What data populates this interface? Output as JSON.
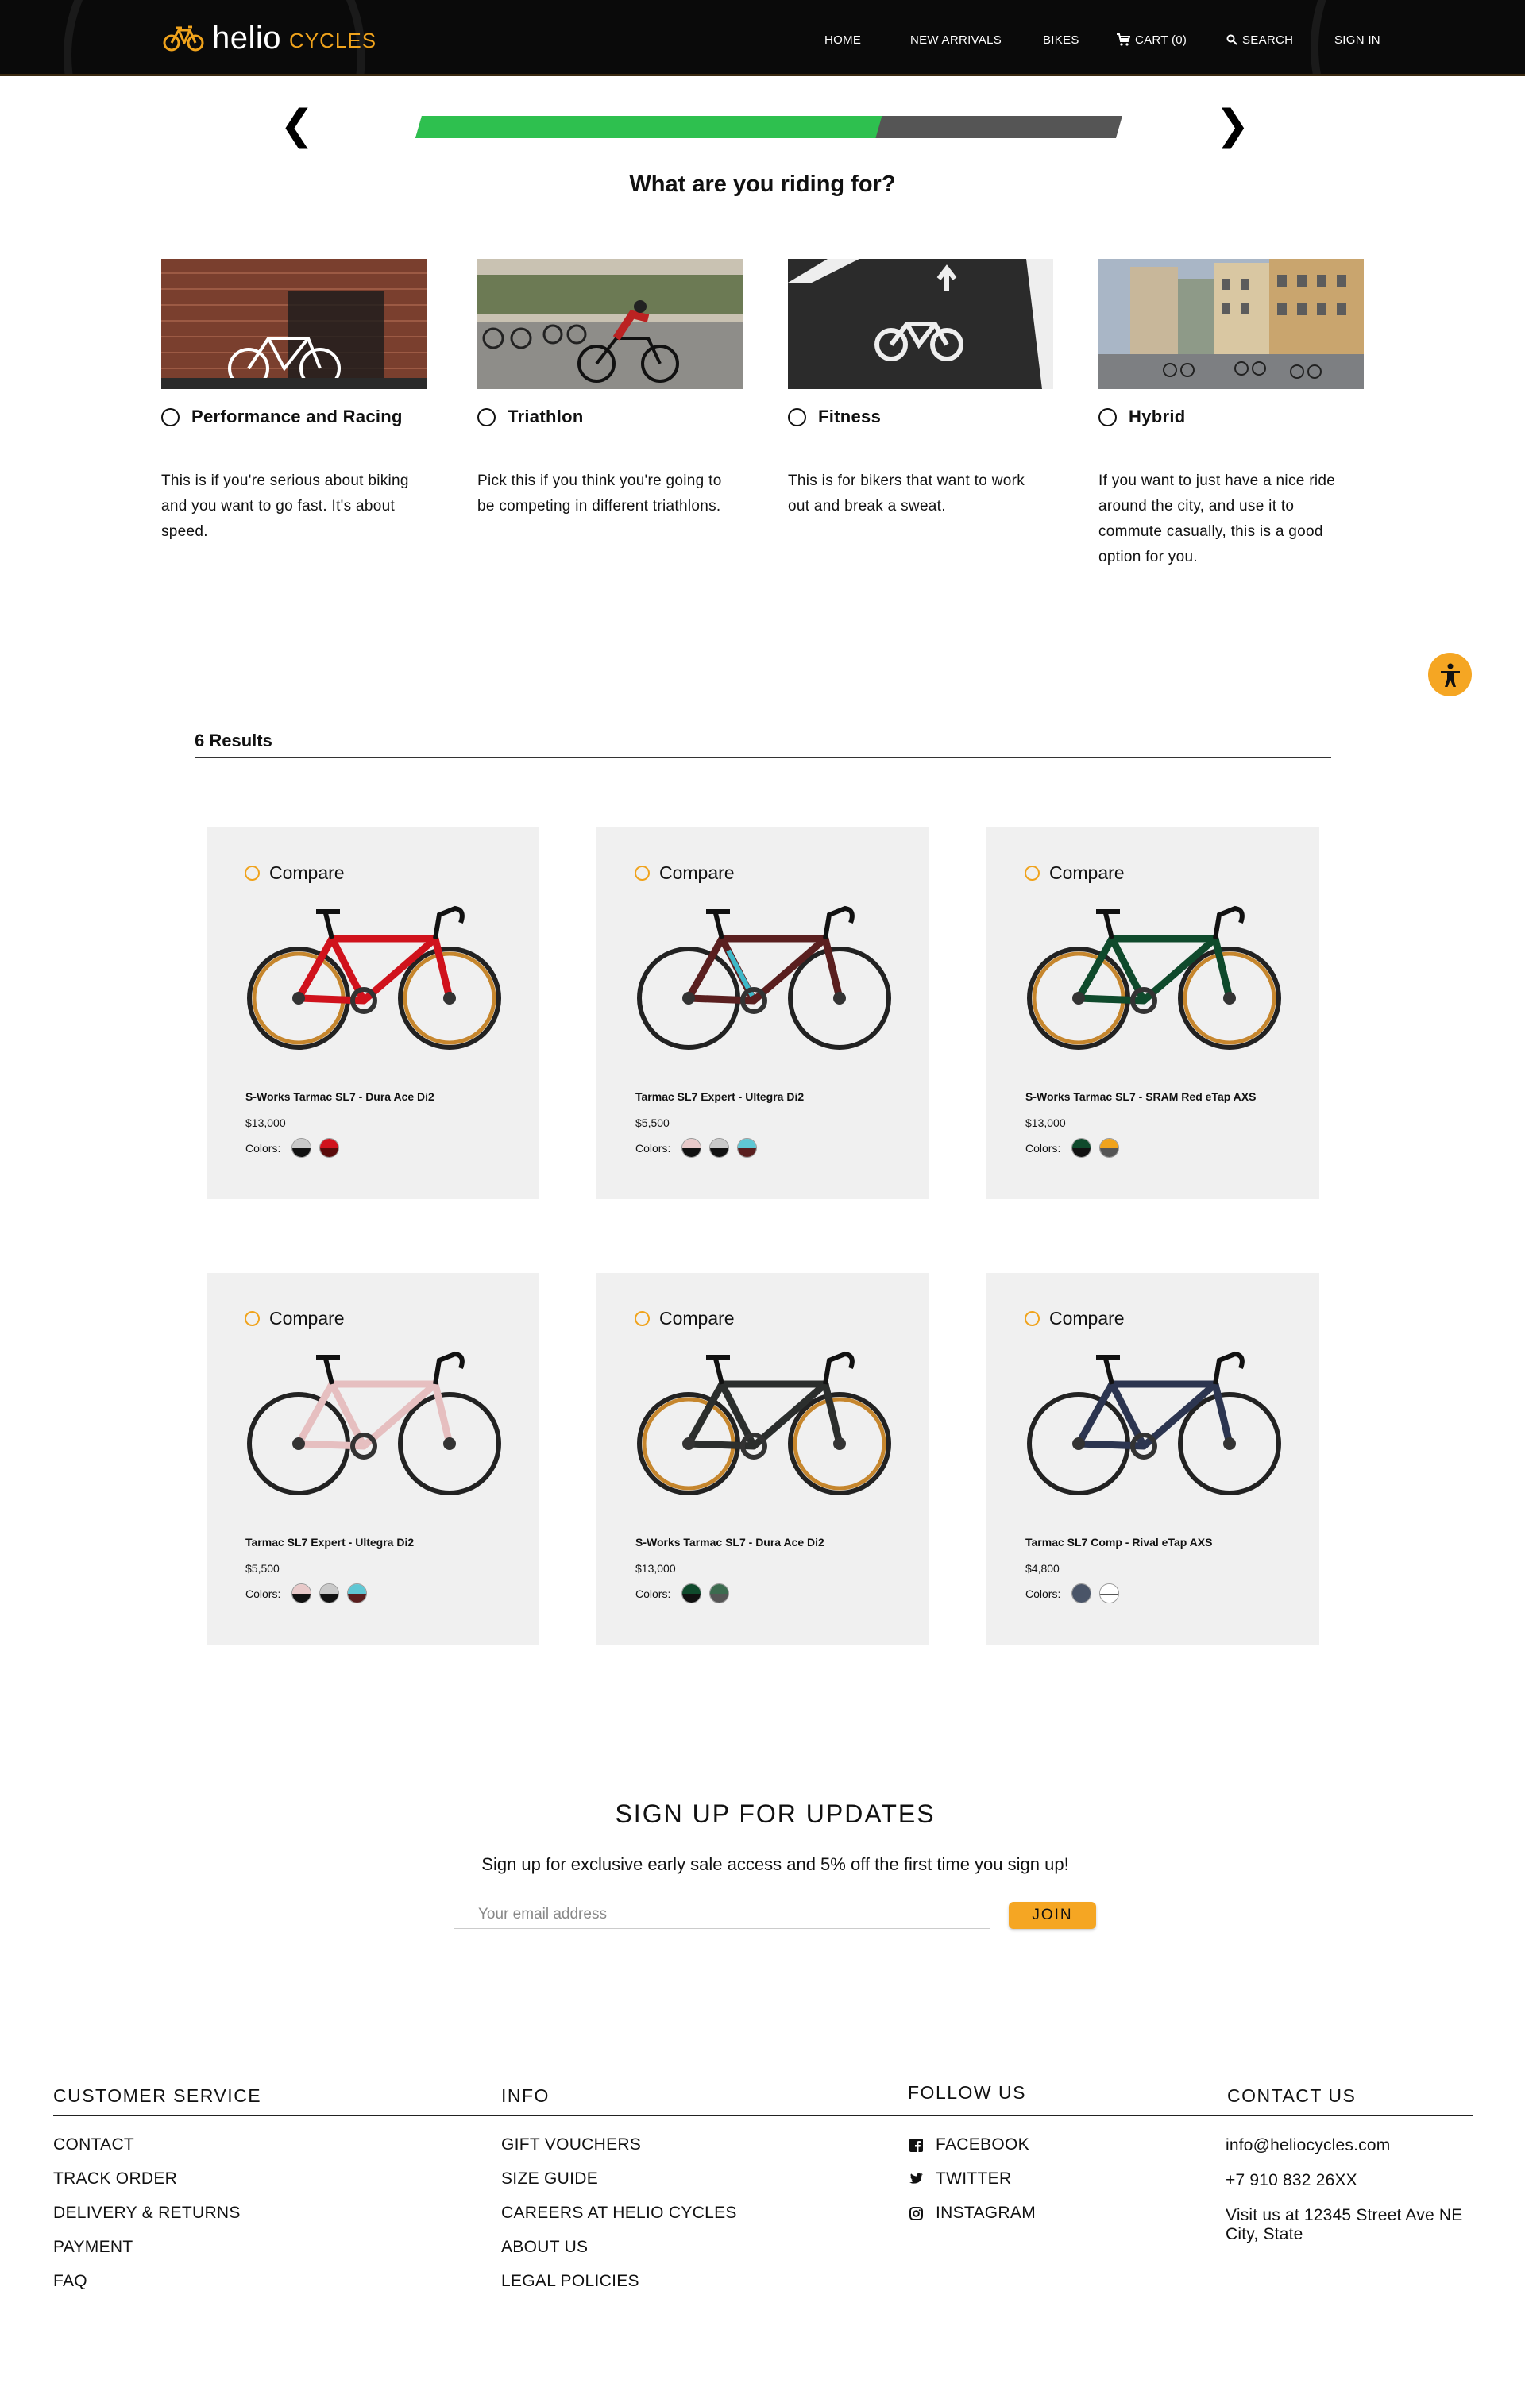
{
  "header": {
    "brand": "helio",
    "brand_suffix": "CYCLES",
    "nav": {
      "home": "HOME",
      "new_arrivals": "NEW ARRIVALS",
      "bikes": "BIKES",
      "cart": "CART (0)",
      "search": "SEARCH",
      "sign_in": "SIGN IN"
    }
  },
  "quiz": {
    "prev": "❮",
    "next": "❯",
    "progress": 0.66,
    "question": "What are you riding for?",
    "options": [
      {
        "label": "Performance and Racing",
        "description": "This is if you're serious about biking and you want to go fast. It's about speed."
      },
      {
        "label": "Triathlon",
        "description": "Pick this if you think you're going to be competing in different triathlons."
      },
      {
        "label": "Fitness",
        "description": "This is for bikers that want to work out and break a sweat."
      },
      {
        "label": "Hybrid",
        "description": "If you want to just have a nice ride around the city, and use it to commute casually, this is a good option for you."
      }
    ]
  },
  "results": {
    "count_label": "6 Results",
    "compare_label": "Compare",
    "colors_label": "Colors:",
    "products": [
      {
        "name": "S-Works Tarmac SL7 - Dura Ace Di2",
        "price": "$13,000"
      },
      {
        "name": "Tarmac SL7 Expert - Ultegra Di2",
        "price": "$5,500"
      },
      {
        "name": "S-Works Tarmac SL7 - SRAM Red eTap AXS",
        "price": "$13,000"
      },
      {
        "name": "Tarmac SL7 Expert - Ultegra Di2",
        "price": "$5,500"
      },
      {
        "name": "S-Works Tarmac SL7 - Dura Ace Di2",
        "price": "$13,000"
      },
      {
        "name": "Tarmac SL7 Comp - Rival eTap AXS",
        "price": "$4,800"
      }
    ]
  },
  "signup": {
    "title": "SIGN UP FOR UPDATES",
    "subtitle": "Sign up for exclusive early sale access and 5% off the first time you sign up!",
    "email_placeholder": "Your email address",
    "join": "JOIN"
  },
  "footer": {
    "customer_service": {
      "title": "CUSTOMER SERVICE",
      "items": [
        "CONTACT",
        "TRACK ORDER",
        "DELIVERY & RETURNS",
        "PAYMENT",
        "FAQ"
      ]
    },
    "info": {
      "title": "INFO",
      "items": [
        "GIFT VOUCHERS",
        "SIZE GUIDE",
        "CAREERS AT HELIO CYCLES",
        "ABOUT US",
        "LEGAL POLICIES"
      ]
    },
    "follow": {
      "title": "FOLLOW US",
      "items": [
        "FACEBOOK",
        "TWITTER",
        "INSTAGRAM"
      ]
    },
    "contact": {
      "title": "CONTACT US",
      "email": "info@heliocycles.com",
      "phone": "+7 910 832 26XX",
      "address_1": "Visit us at 12345 Street Ave NE",
      "address_2": "City, State"
    }
  },
  "colors": {
    "accent": "#f5a623",
    "progress_fill": "#2ec04f",
    "progress_track": "#555555",
    "card_bg": "#f0f0f0"
  }
}
